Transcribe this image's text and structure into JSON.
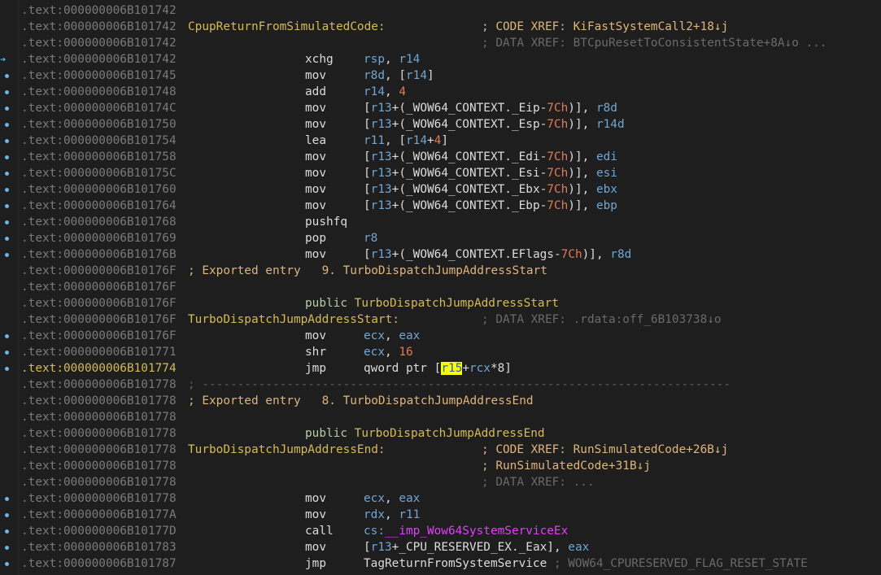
{
  "lines": [
    {
      "addr": ".text:000000006B101742",
      "cur": false,
      "gutter": ""
    },
    {
      "addr": ".text:000000006B101742",
      "label": "CpupReturnFromSimulatedCode:",
      "xref": "; CODE XREF: KiFastSystemCall2+18↓j",
      "xref_dim": false,
      "gutter": ""
    },
    {
      "addr": ".text:000000006B101742",
      "xref": "; DATA XREF: BTCpuResetToConsistentState+8A↓o ...",
      "xref_dim": true,
      "gutter": ""
    },
    {
      "addr": ".text:000000006B101742",
      "mn": "xchg",
      "op": [
        [
          "reg",
          "rsp"
        ],
        [
          "t",
          ", "
        ],
        [
          "reg",
          "r14"
        ]
      ],
      "gutter": "arrow"
    },
    {
      "addr": ".text:000000006B101745",
      "mn": "mov",
      "op": [
        [
          "reg",
          "r8d"
        ],
        [
          "t",
          ", ["
        ],
        [
          "reg",
          "r14"
        ],
        [
          "t",
          "]"
        ]
      ],
      "gutter": "dot"
    },
    {
      "addr": ".text:000000006B101748",
      "mn": "add",
      "op": [
        [
          "reg",
          "r14"
        ],
        [
          "t",
          ", "
        ],
        [
          "num",
          "4"
        ]
      ],
      "gutter": "dot"
    },
    {
      "addr": ".text:000000006B10174C",
      "mn": "mov",
      "op": [
        [
          "t",
          "["
        ],
        [
          "reg",
          "r13"
        ],
        [
          "t",
          "+("
        ],
        [
          "s",
          "_WOW64_CONTEXT._Eip"
        ],
        [
          "t",
          "-"
        ],
        [
          "num",
          "7Ch"
        ],
        [
          "t",
          ")], "
        ],
        [
          "reg",
          "r8d"
        ]
      ],
      "gutter": "dot"
    },
    {
      "addr": ".text:000000006B101750",
      "mn": "mov",
      "op": [
        [
          "t",
          "["
        ],
        [
          "reg",
          "r13"
        ],
        [
          "t",
          "+("
        ],
        [
          "s",
          "_WOW64_CONTEXT._Esp"
        ],
        [
          "t",
          "-"
        ],
        [
          "num",
          "7Ch"
        ],
        [
          "t",
          ")], "
        ],
        [
          "reg",
          "r14d"
        ]
      ],
      "gutter": "dot"
    },
    {
      "addr": ".text:000000006B101754",
      "mn": "lea",
      "op": [
        [
          "reg",
          "r11"
        ],
        [
          "t",
          ", ["
        ],
        [
          "reg",
          "r14"
        ],
        [
          "t",
          "+"
        ],
        [
          "num",
          "4"
        ],
        [
          "t",
          "]"
        ]
      ],
      "gutter": "dot"
    },
    {
      "addr": ".text:000000006B101758",
      "mn": "mov",
      "op": [
        [
          "t",
          "["
        ],
        [
          "reg",
          "r13"
        ],
        [
          "t",
          "+("
        ],
        [
          "s",
          "_WOW64_CONTEXT._Edi"
        ],
        [
          "t",
          "-"
        ],
        [
          "num",
          "7Ch"
        ],
        [
          "t",
          ")], "
        ],
        [
          "reg",
          "edi"
        ]
      ],
      "gutter": "dot"
    },
    {
      "addr": ".text:000000006B10175C",
      "mn": "mov",
      "op": [
        [
          "t",
          "["
        ],
        [
          "reg",
          "r13"
        ],
        [
          "t",
          "+("
        ],
        [
          "s",
          "_WOW64_CONTEXT._Esi"
        ],
        [
          "t",
          "-"
        ],
        [
          "num",
          "7Ch"
        ],
        [
          "t",
          ")], "
        ],
        [
          "reg",
          "esi"
        ]
      ],
      "gutter": "dot"
    },
    {
      "addr": ".text:000000006B101760",
      "mn": "mov",
      "op": [
        [
          "t",
          "["
        ],
        [
          "reg",
          "r13"
        ],
        [
          "t",
          "+("
        ],
        [
          "s",
          "_WOW64_CONTEXT._Ebx"
        ],
        [
          "t",
          "-"
        ],
        [
          "num",
          "7Ch"
        ],
        [
          "t",
          ")], "
        ],
        [
          "reg",
          "ebx"
        ]
      ],
      "gutter": "dot"
    },
    {
      "addr": ".text:000000006B101764",
      "mn": "mov",
      "op": [
        [
          "t",
          "["
        ],
        [
          "reg",
          "r13"
        ],
        [
          "t",
          "+("
        ],
        [
          "s",
          "_WOW64_CONTEXT._Ebp"
        ],
        [
          "t",
          "-"
        ],
        [
          "num",
          "7Ch"
        ],
        [
          "t",
          ")], "
        ],
        [
          "reg",
          "ebp"
        ]
      ],
      "gutter": "dot"
    },
    {
      "addr": ".text:000000006B101768",
      "mn": "pushfq",
      "op": [],
      "gutter": "dot"
    },
    {
      "addr": ".text:000000006B101769",
      "mn": "pop",
      "op": [
        [
          "reg",
          "r8"
        ]
      ],
      "gutter": "dot"
    },
    {
      "addr": ".text:000000006B10176B",
      "mn": "mov",
      "op": [
        [
          "t",
          "["
        ],
        [
          "reg",
          "r13"
        ],
        [
          "t",
          "+("
        ],
        [
          "s",
          "_WOW64_CONTEXT.EFlags"
        ],
        [
          "t",
          "-"
        ],
        [
          "num",
          "7Ch"
        ],
        [
          "t",
          ")], "
        ],
        [
          "reg",
          "r8d"
        ]
      ],
      "gutter": "dot"
    },
    {
      "addr": ".text:000000006B10176F",
      "comment": "; Exported entry   9. TurboDispatchJumpAddressStart",
      "gutter": ""
    },
    {
      "addr": ".text:000000006B10176F",
      "gutter": ""
    },
    {
      "addr": ".text:000000006B10176F",
      "public": "TurboDispatchJumpAddressStart",
      "gutter": ""
    },
    {
      "addr": ".text:000000006B10176F",
      "label": "TurboDispatchJumpAddressStart:",
      "xref": "; DATA XREF: .rdata:off_6B103738↓o",
      "xref_dim": true,
      "gutter": ""
    },
    {
      "addr": ".text:000000006B10176F",
      "mn": "mov",
      "op": [
        [
          "reg",
          "ecx"
        ],
        [
          "t",
          ", "
        ],
        [
          "reg",
          "eax"
        ]
      ],
      "gutter": "dot"
    },
    {
      "addr": ".text:000000006B101771",
      "mn": "shr",
      "op": [
        [
          "reg",
          "ecx"
        ],
        [
          "t",
          ", "
        ],
        [
          "num",
          "16"
        ]
      ],
      "gutter": "dot"
    },
    {
      "addr": ".text:000000006B101774",
      "cur": true,
      "mn": "jmp",
      "op": [
        [
          "t",
          "qword ptr ["
        ],
        [
          "hl",
          "r15"
        ],
        [
          "t",
          "+"
        ],
        [
          "reg",
          "rcx"
        ],
        [
          "t",
          "*8]"
        ]
      ],
      "gutter": "dot"
    },
    {
      "addr": ".text:000000006B101778",
      "sep": "; ---------------------------------------------------------------------------",
      "gutter": ""
    },
    {
      "addr": ".text:000000006B101778",
      "comment": "; Exported entry   8. TurboDispatchJumpAddressEnd",
      "gutter": ""
    },
    {
      "addr": ".text:000000006B101778",
      "gutter": ""
    },
    {
      "addr": ".text:000000006B101778",
      "public": "TurboDispatchJumpAddressEnd",
      "gutter": ""
    },
    {
      "addr": ".text:000000006B101778",
      "label": "TurboDispatchJumpAddressEnd:",
      "xref": "; CODE XREF: RunSimulatedCode+26B↓j",
      "xref_dim": false,
      "gutter": ""
    },
    {
      "addr": ".text:000000006B101778",
      "xref": "; RunSimulatedCode+31B↓j",
      "xref_dim": false,
      "gutter": ""
    },
    {
      "addr": ".text:000000006B101778",
      "xref": "; DATA XREF: ...",
      "xref_dim": true,
      "gutter": ""
    },
    {
      "addr": ".text:000000006B101778",
      "mn": "mov",
      "op": [
        [
          "reg",
          "ecx"
        ],
        [
          "t",
          ", "
        ],
        [
          "reg",
          "eax"
        ]
      ],
      "gutter": "dot"
    },
    {
      "addr": ".text:000000006B10177A",
      "mn": "mov",
      "op": [
        [
          "reg",
          "rdx"
        ],
        [
          "t",
          ", "
        ],
        [
          "reg",
          "r11"
        ]
      ],
      "gutter": "dot"
    },
    {
      "addr": ".text:000000006B10177D",
      "mn": "call",
      "op": [
        [
          "reg",
          "cs:"
        ],
        [
          "imp",
          "__imp_Wow64SystemServiceEx"
        ]
      ],
      "gutter": "dot"
    },
    {
      "addr": ".text:000000006B101783",
      "mn": "mov",
      "op": [
        [
          "t",
          "["
        ],
        [
          "reg",
          "r13"
        ],
        [
          "t",
          "+"
        ],
        [
          "s",
          "_CPU_RESERVED_EX._Eax"
        ],
        [
          "t",
          "], "
        ],
        [
          "reg",
          "eax"
        ]
      ],
      "gutter": "dot"
    },
    {
      "addr": ".text:000000006B101787",
      "mn": "jmp",
      "op": [
        [
          "s",
          "TagReturnFromSystemService"
        ],
        [
          "t",
          " "
        ],
        [
          "dim",
          "; WOW64_CPURESERVED_FLAG_RESET_STATE"
        ]
      ],
      "gutter": "dot"
    }
  ],
  "public_keyword": "public",
  "colors": {
    "background": "#1e1e1e",
    "address": "#7a7a7a",
    "current_address": "#d7ba55",
    "label": "#d7ba55",
    "register": "#6fa6d6",
    "number": "#e07b53",
    "xref": "#e0b47a",
    "dim_comment": "#6a6a6a",
    "import": "#e040fb",
    "highlight": "#ffff00"
  }
}
